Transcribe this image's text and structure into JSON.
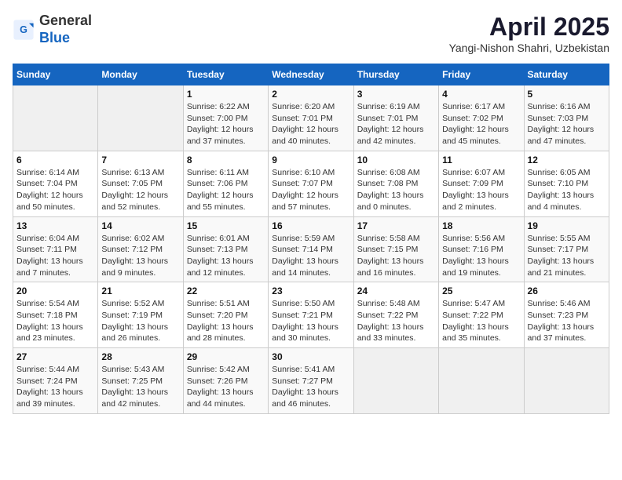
{
  "header": {
    "logo_general": "General",
    "logo_blue": "Blue",
    "month": "April 2025",
    "location": "Yangi-Nishon Shahri, Uzbekistan"
  },
  "weekdays": [
    "Sunday",
    "Monday",
    "Tuesday",
    "Wednesday",
    "Thursday",
    "Friday",
    "Saturday"
  ],
  "weeks": [
    [
      {
        "day": "",
        "info": ""
      },
      {
        "day": "",
        "info": ""
      },
      {
        "day": "1",
        "info": "Sunrise: 6:22 AM\nSunset: 7:00 PM\nDaylight: 12 hours and 37 minutes."
      },
      {
        "day": "2",
        "info": "Sunrise: 6:20 AM\nSunset: 7:01 PM\nDaylight: 12 hours and 40 minutes."
      },
      {
        "day": "3",
        "info": "Sunrise: 6:19 AM\nSunset: 7:01 PM\nDaylight: 12 hours and 42 minutes."
      },
      {
        "day": "4",
        "info": "Sunrise: 6:17 AM\nSunset: 7:02 PM\nDaylight: 12 hours and 45 minutes."
      },
      {
        "day": "5",
        "info": "Sunrise: 6:16 AM\nSunset: 7:03 PM\nDaylight: 12 hours and 47 minutes."
      }
    ],
    [
      {
        "day": "6",
        "info": "Sunrise: 6:14 AM\nSunset: 7:04 PM\nDaylight: 12 hours and 50 minutes."
      },
      {
        "day": "7",
        "info": "Sunrise: 6:13 AM\nSunset: 7:05 PM\nDaylight: 12 hours and 52 minutes."
      },
      {
        "day": "8",
        "info": "Sunrise: 6:11 AM\nSunset: 7:06 PM\nDaylight: 12 hours and 55 minutes."
      },
      {
        "day": "9",
        "info": "Sunrise: 6:10 AM\nSunset: 7:07 PM\nDaylight: 12 hours and 57 minutes."
      },
      {
        "day": "10",
        "info": "Sunrise: 6:08 AM\nSunset: 7:08 PM\nDaylight: 13 hours and 0 minutes."
      },
      {
        "day": "11",
        "info": "Sunrise: 6:07 AM\nSunset: 7:09 PM\nDaylight: 13 hours and 2 minutes."
      },
      {
        "day": "12",
        "info": "Sunrise: 6:05 AM\nSunset: 7:10 PM\nDaylight: 13 hours and 4 minutes."
      }
    ],
    [
      {
        "day": "13",
        "info": "Sunrise: 6:04 AM\nSunset: 7:11 PM\nDaylight: 13 hours and 7 minutes."
      },
      {
        "day": "14",
        "info": "Sunrise: 6:02 AM\nSunset: 7:12 PM\nDaylight: 13 hours and 9 minutes."
      },
      {
        "day": "15",
        "info": "Sunrise: 6:01 AM\nSunset: 7:13 PM\nDaylight: 13 hours and 12 minutes."
      },
      {
        "day": "16",
        "info": "Sunrise: 5:59 AM\nSunset: 7:14 PM\nDaylight: 13 hours and 14 minutes."
      },
      {
        "day": "17",
        "info": "Sunrise: 5:58 AM\nSunset: 7:15 PM\nDaylight: 13 hours and 16 minutes."
      },
      {
        "day": "18",
        "info": "Sunrise: 5:56 AM\nSunset: 7:16 PM\nDaylight: 13 hours and 19 minutes."
      },
      {
        "day": "19",
        "info": "Sunrise: 5:55 AM\nSunset: 7:17 PM\nDaylight: 13 hours and 21 minutes."
      }
    ],
    [
      {
        "day": "20",
        "info": "Sunrise: 5:54 AM\nSunset: 7:18 PM\nDaylight: 13 hours and 23 minutes."
      },
      {
        "day": "21",
        "info": "Sunrise: 5:52 AM\nSunset: 7:19 PM\nDaylight: 13 hours and 26 minutes."
      },
      {
        "day": "22",
        "info": "Sunrise: 5:51 AM\nSunset: 7:20 PM\nDaylight: 13 hours and 28 minutes."
      },
      {
        "day": "23",
        "info": "Sunrise: 5:50 AM\nSunset: 7:21 PM\nDaylight: 13 hours and 30 minutes."
      },
      {
        "day": "24",
        "info": "Sunrise: 5:48 AM\nSunset: 7:22 PM\nDaylight: 13 hours and 33 minutes."
      },
      {
        "day": "25",
        "info": "Sunrise: 5:47 AM\nSunset: 7:22 PM\nDaylight: 13 hours and 35 minutes."
      },
      {
        "day": "26",
        "info": "Sunrise: 5:46 AM\nSunset: 7:23 PM\nDaylight: 13 hours and 37 minutes."
      }
    ],
    [
      {
        "day": "27",
        "info": "Sunrise: 5:44 AM\nSunset: 7:24 PM\nDaylight: 13 hours and 39 minutes."
      },
      {
        "day": "28",
        "info": "Sunrise: 5:43 AM\nSunset: 7:25 PM\nDaylight: 13 hours and 42 minutes."
      },
      {
        "day": "29",
        "info": "Sunrise: 5:42 AM\nSunset: 7:26 PM\nDaylight: 13 hours and 44 minutes."
      },
      {
        "day": "30",
        "info": "Sunrise: 5:41 AM\nSunset: 7:27 PM\nDaylight: 13 hours and 46 minutes."
      },
      {
        "day": "",
        "info": ""
      },
      {
        "day": "",
        "info": ""
      },
      {
        "day": "",
        "info": ""
      }
    ]
  ]
}
